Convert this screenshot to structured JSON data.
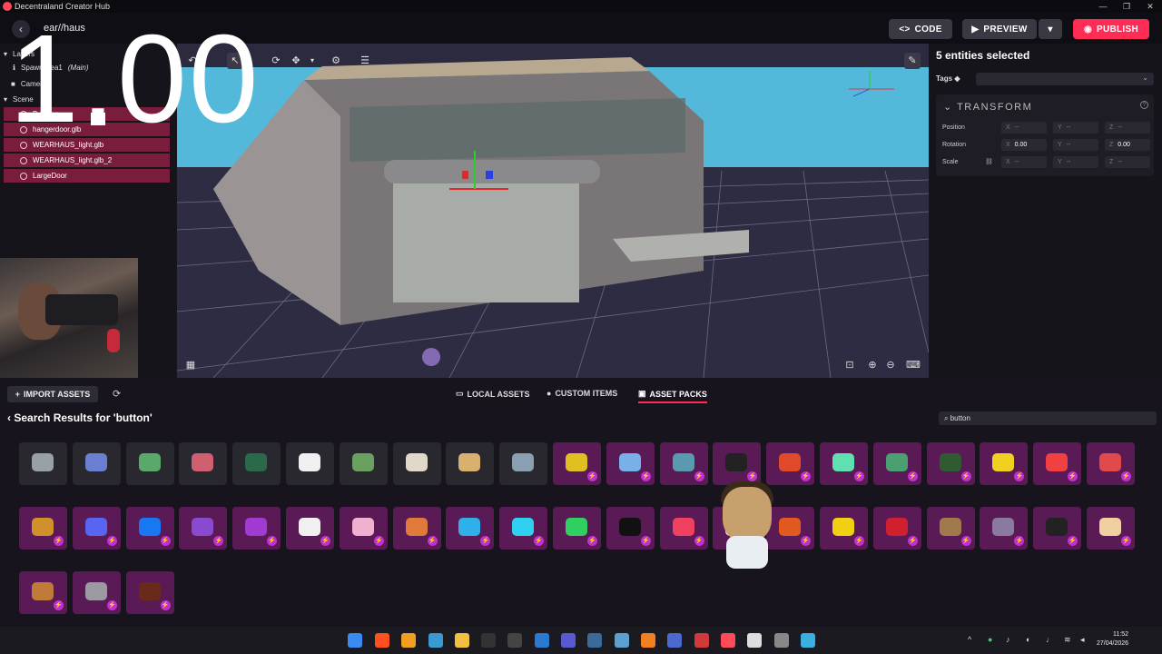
{
  "app": {
    "title": "Decentraland Creator Hub",
    "scene_name": "ear//haus",
    "overlay_text": "1.00"
  },
  "header": {
    "code": "CODE",
    "preview": "PREVIEW",
    "publish": "PUBLISH"
  },
  "window_controls": [
    "—",
    "❐",
    "✕"
  ],
  "left_panel": {
    "tree": [
      {
        "label": "Layers",
        "icon": "▾"
      },
      {
        "label": "SpawnArea1",
        "tag": "(Main)",
        "icon": "ℹ"
      },
      {
        "label": "Camera",
        "icon": "■"
      },
      {
        "label": "Scene",
        "icon": "▾"
      }
    ],
    "selected": [
      "Building",
      "hangerdoor.glb",
      "WEARHAUS_light.glb",
      "WEARHAUS_light.glb_2",
      "LargeDoor"
    ]
  },
  "inspector": {
    "title": "5 entities selected",
    "tags_label": "Tags",
    "section": "TRANSFORM",
    "position_label": "Position",
    "rotation_label": "Rotation",
    "scale_label": "Scale",
    "axes": [
      "X",
      "Y",
      "Z"
    ],
    "empty": "--",
    "rotation_x": "0.00",
    "rotation_z": "0.00"
  },
  "assets": {
    "import": "IMPORT ASSETS",
    "tabs": [
      "LOCAL ASSETS",
      "CUSTOM ITEMS",
      "ASSET PACKS"
    ],
    "search_title": "Search Results for 'button'",
    "search_value": "button",
    "tiles": [
      {
        "style": "gray",
        "color": "#9aa0a8"
      },
      {
        "style": "gray",
        "color": "#6b7fd0"
      },
      {
        "style": "gray",
        "color": "#5aa86a"
      },
      {
        "style": "gray",
        "color": "#d06070"
      },
      {
        "style": "gray",
        "color": "#2a6a4a"
      },
      {
        "style": "gray",
        "color": "#f0f0f0"
      },
      {
        "style": "gray",
        "color": "#6aa060"
      },
      {
        "style": "gray",
        "color": "#e0d8c8"
      },
      {
        "style": "gray",
        "color": "#d8b070"
      },
      {
        "style": "gray",
        "color": "#8aa0b0"
      },
      {
        "style": "purple",
        "color": "#e0c020"
      },
      {
        "style": "purple",
        "color": "#7ab0e8"
      },
      {
        "style": "purple",
        "color": "#5a9ab0"
      },
      {
        "style": "purple",
        "color": "#222"
      },
      {
        "style": "purple",
        "color": "#e04a2a"
      },
      {
        "style": "purple",
        "color": "#60e0b0"
      },
      {
        "style": "purple",
        "color": "#4aa070"
      },
      {
        "style": "purple",
        "color": "#305a30"
      },
      {
        "style": "purple",
        "color": "#f0d020"
      },
      {
        "style": "purple",
        "color": "#f04040"
      },
      {
        "style": "purple",
        "color": "#e04a4a"
      },
      {
        "style": "purple",
        "color": "#d0902a"
      },
      {
        "style": "purple",
        "color": "#5865f2"
      },
      {
        "style": "purple",
        "color": "#1877f2"
      },
      {
        "style": "purple",
        "color": "#8a4ad0"
      },
      {
        "style": "purple",
        "color": "#a03ad0"
      },
      {
        "style": "purple",
        "color": "#f0f0f0"
      },
      {
        "style": "purple",
        "color": "#f0b0d0"
      },
      {
        "style": "purple",
        "color": "#e07a3a"
      },
      {
        "style": "purple",
        "color": "#30b0e8"
      },
      {
        "style": "purple",
        "color": "#30d0f0"
      },
      {
        "style": "purple",
        "color": "#30d060"
      },
      {
        "style": "purple",
        "color": "#111"
      },
      {
        "style": "purple",
        "color": "#f04060"
      },
      {
        "style": "purple",
        "color": "#e0e0e0"
      },
      {
        "style": "purple",
        "color": "#e05a20"
      },
      {
        "style": "purple",
        "color": "#f0d010"
      },
      {
        "style": "purple",
        "color": "#d02030"
      },
      {
        "style": "purple",
        "color": "#a07a4a"
      },
      {
        "style": "purple",
        "color": "#8a7aa0"
      },
      {
        "style": "purple",
        "color": "#222"
      },
      {
        "style": "purple",
        "color": "#f0d0a0"
      },
      {
        "style": "purple",
        "color": "#c07a3a"
      },
      {
        "style": "purple",
        "color": "#9a9aa0"
      },
      {
        "style": "purple",
        "color": "#6a2a1a"
      }
    ]
  },
  "taskbar": {
    "time": "11:52",
    "date": "27/04/2026"
  }
}
